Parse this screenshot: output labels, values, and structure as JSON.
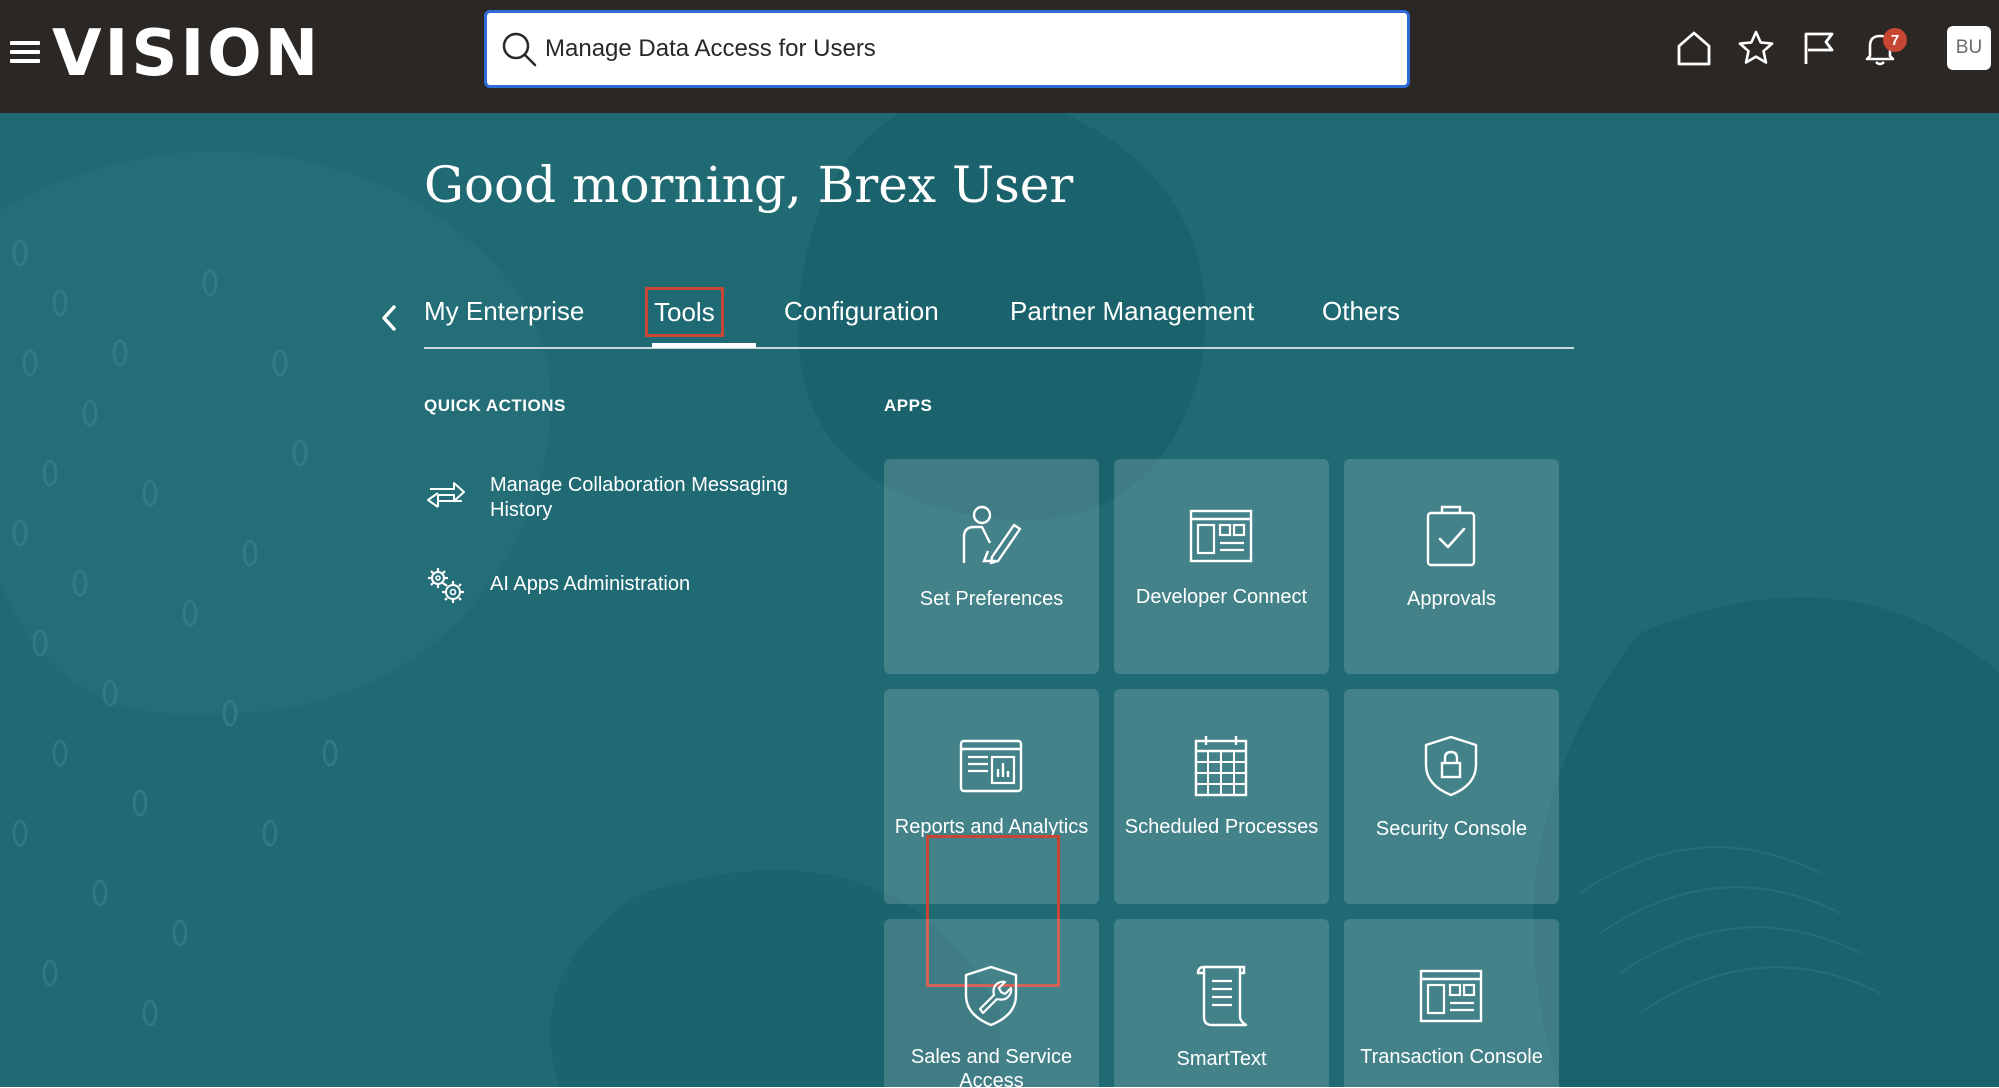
{
  "header": {
    "logo_text": "VISION",
    "search": {
      "value": "Manage Data Access for Users",
      "placeholder": ""
    },
    "icons": [
      "home-icon",
      "star-icon",
      "flag-icon",
      "bell-icon"
    ],
    "notification_count": "7",
    "avatar_initials": "BU"
  },
  "main": {
    "greeting": "Good morning, Brex User",
    "tabs": [
      {
        "label": "My Enterprise"
      },
      {
        "label": "Tools"
      },
      {
        "label": "Configuration"
      },
      {
        "label": "Partner Management"
      },
      {
        "label": "Others"
      }
    ],
    "selected_tab": "Tools",
    "quick_actions": {
      "title": "QUICK ACTIONS",
      "items": [
        {
          "label": "Manage Collaboration Messaging History",
          "icon": "arrows-exchange-icon"
        },
        {
          "label": "AI Apps Administration",
          "icon": "gears-icon"
        }
      ]
    },
    "apps": {
      "title": "APPS",
      "tiles": [
        {
          "label": "Set Preferences",
          "icon": "person-pen-icon"
        },
        {
          "label": "Developer Connect",
          "icon": "dashboard-window-icon"
        },
        {
          "label": "Approvals",
          "icon": "clipboard-check-icon"
        },
        {
          "label": "Reports and Analytics",
          "icon": "report-chart-icon"
        },
        {
          "label": "Scheduled Processes",
          "icon": "calendar-grid-icon"
        },
        {
          "label": "Security Console",
          "icon": "shield-lock-icon"
        },
        {
          "label": "Sales and Service Access",
          "icon": "shield-wrench-icon"
        },
        {
          "label": "SmartText",
          "icon": "scroll-document-icon"
        },
        {
          "label": "Transaction Console",
          "icon": "console-window-icon"
        }
      ]
    }
  },
  "colors": {
    "header_bg": "#2b2724",
    "hero_bg": "#1f6a73",
    "highlight": "#c74634",
    "search_border": "#2f6ad6"
  }
}
